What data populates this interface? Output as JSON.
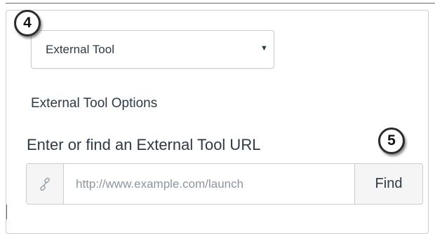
{
  "callouts": {
    "step_4": "4",
    "step_5": "5"
  },
  "content_type_select": {
    "selected": "External Tool",
    "caret_icon": "chevron-down-icon"
  },
  "options": {
    "heading": "External Tool Options",
    "url_label": "Enter or find an External Tool URL",
    "url_input": {
      "value": "",
      "placeholder": "http://www.example.com/launch",
      "icon": "link-icon"
    },
    "find_label": "Find"
  },
  "colors": {
    "text": "#2d3b45",
    "border": "#c8cdd1",
    "addon_bg": "#f5f5f5",
    "placeholder": "#8b969e"
  }
}
